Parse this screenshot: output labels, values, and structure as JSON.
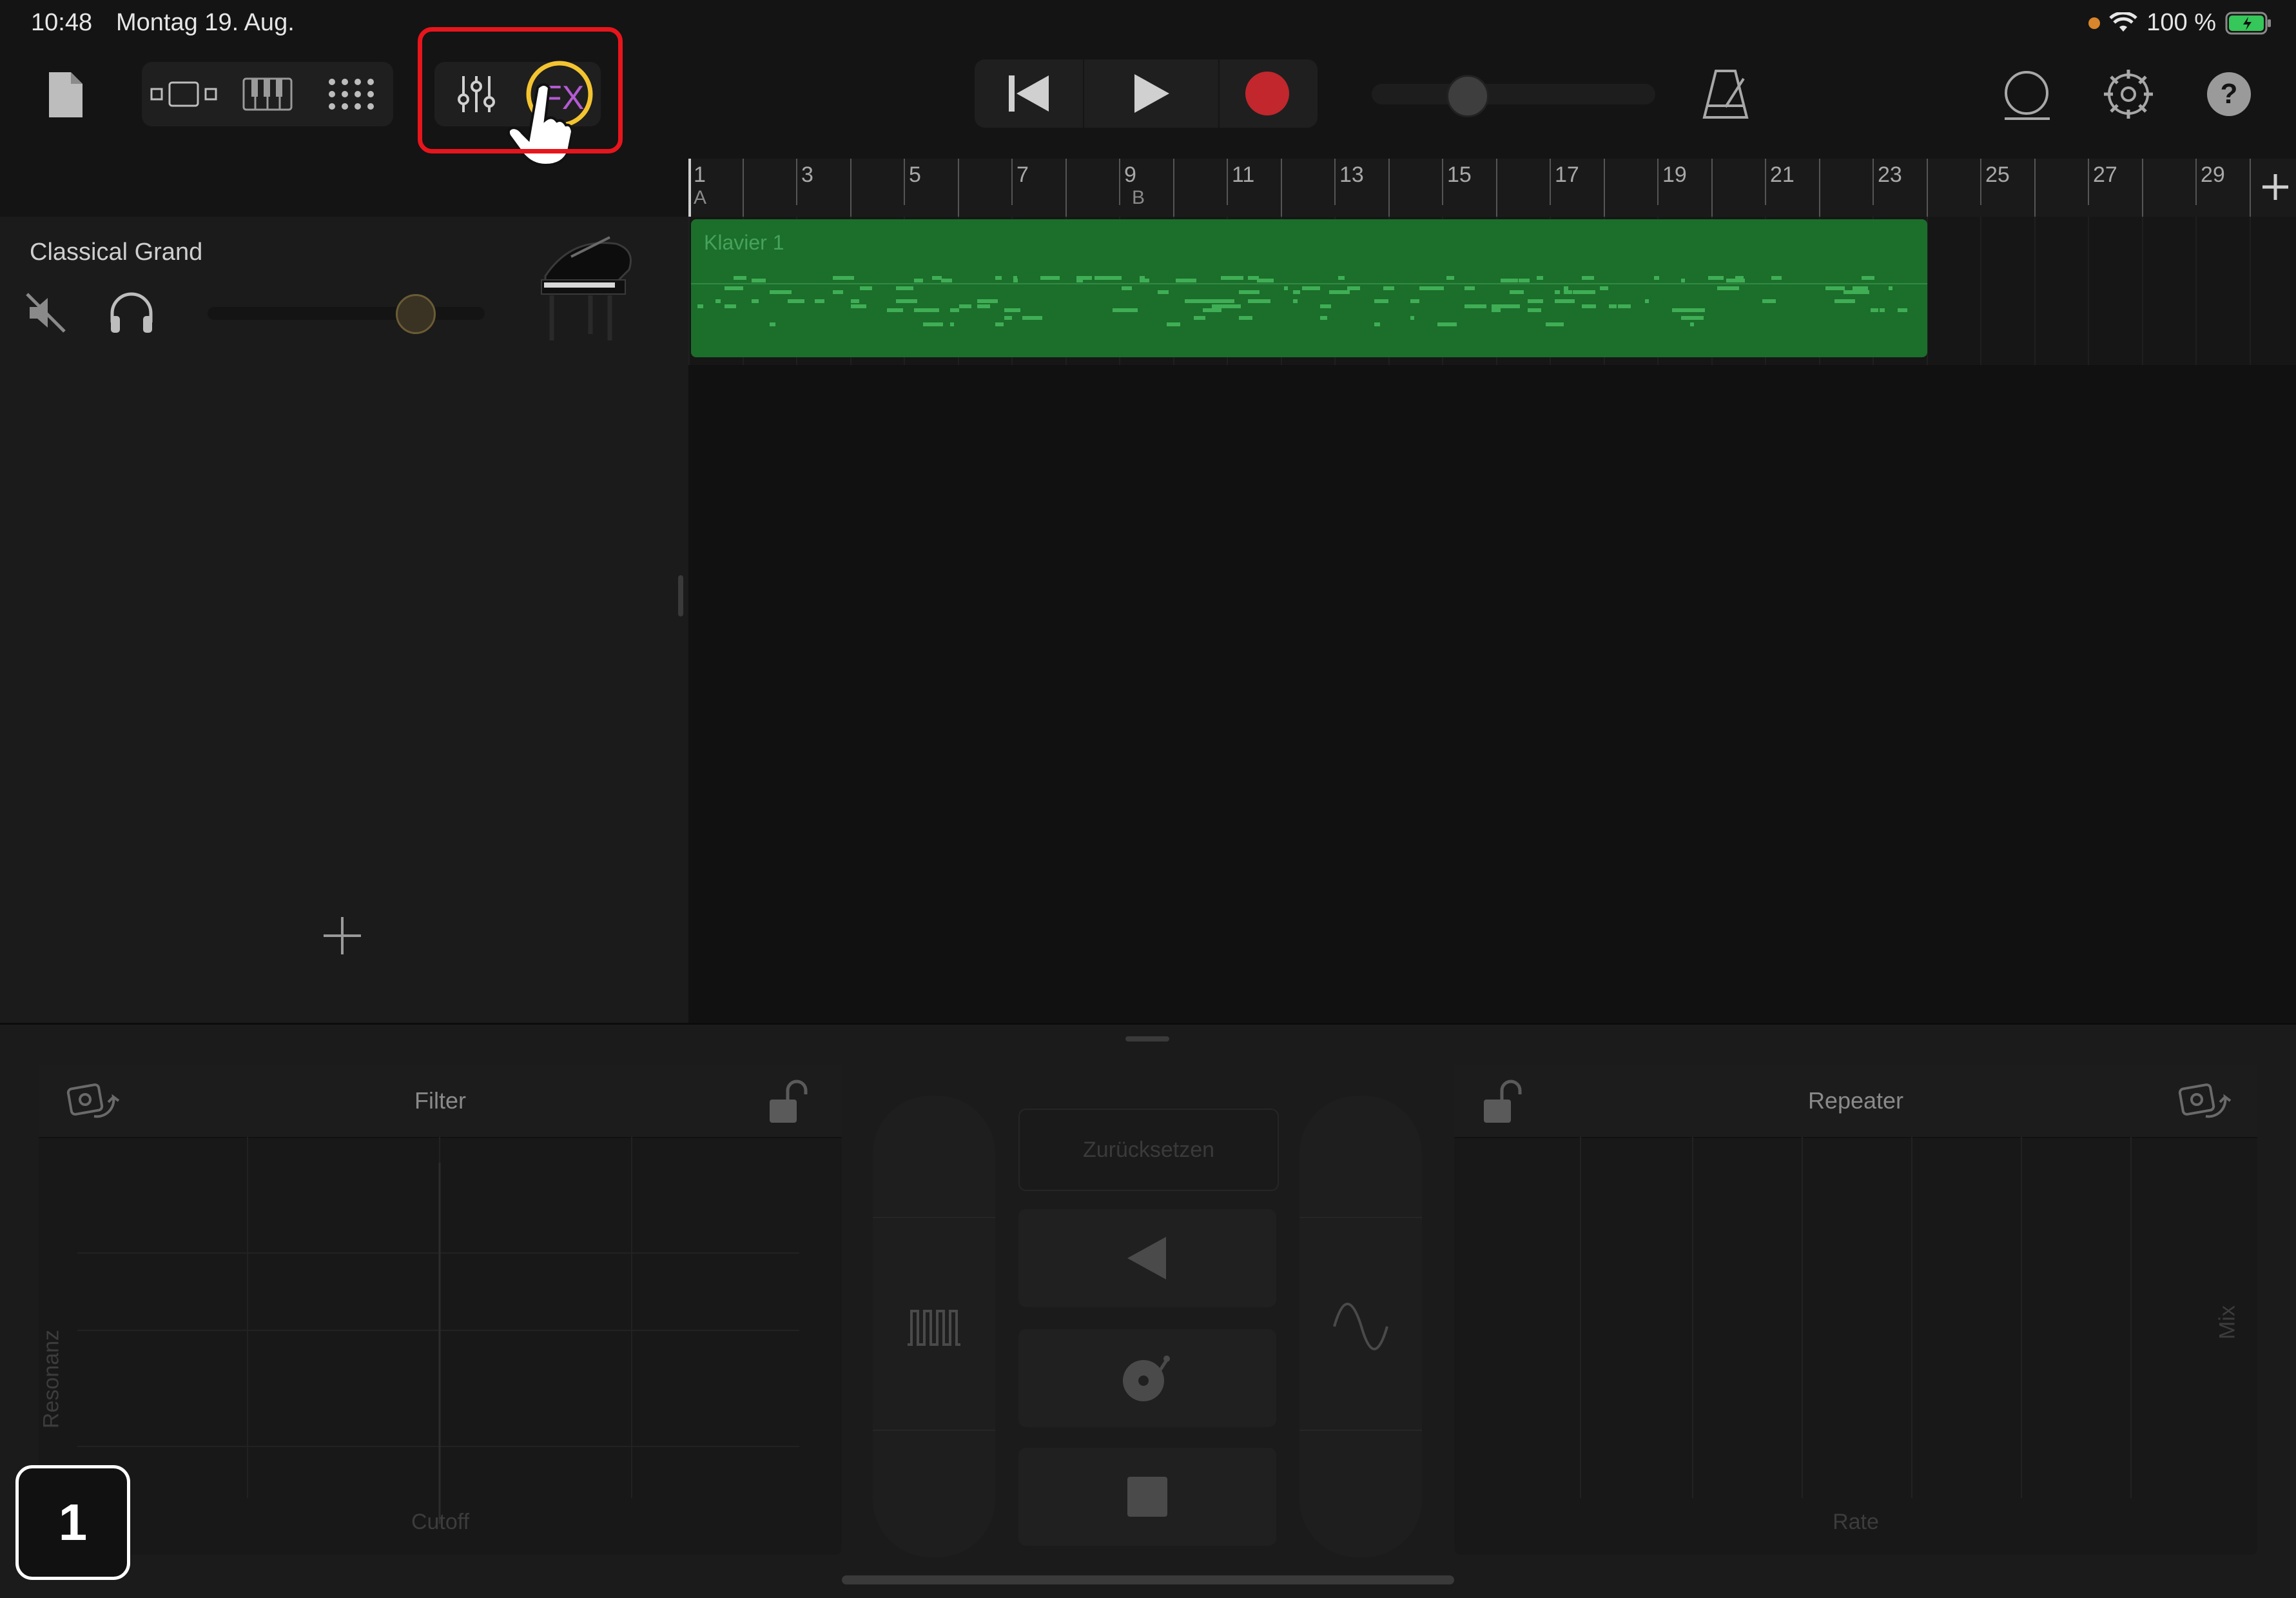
{
  "status": {
    "time": "10:48",
    "date": "Montag 19. Aug.",
    "battery": "100 %"
  },
  "toolbar": {
    "icons": [
      "document-icon",
      "tracks-view-icon",
      "keyboard-icon",
      "grid-icon",
      "mixer-icon",
      "fx-icon",
      "rewind-icon",
      "play-icon",
      "record-icon",
      "metronome-icon",
      "loop-icon",
      "settings-icon",
      "help-icon"
    ],
    "fx_label": "FX",
    "record_color": "#c1272d",
    "highlight_color": "#e8151c"
  },
  "ruler": {
    "bars": [
      "1",
      "3",
      "5",
      "7",
      "9",
      "11",
      "13",
      "15",
      "17",
      "19",
      "21",
      "23",
      "25",
      "27",
      "29"
    ],
    "marker_a": "A",
    "marker_b": "B"
  },
  "track": {
    "name": "Classical Grand",
    "region_name": "Klavier 1",
    "region_color": "#1c6e2b"
  },
  "fx": {
    "left_pad_title": "Filter",
    "left_x_label": "Cutoff",
    "left_y_label": "Resonanz",
    "right_pad_title": "Repeater",
    "right_x_label": "Rate",
    "right_y_label": "Mix",
    "reset_label": "Zurücksetzen"
  },
  "step_badge": "1"
}
